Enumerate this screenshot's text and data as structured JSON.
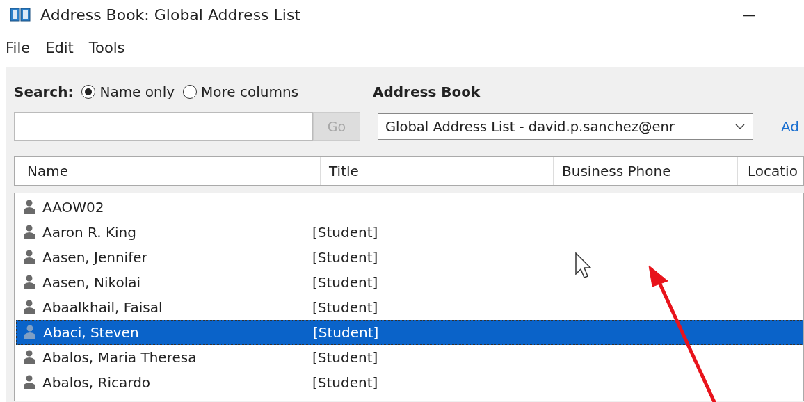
{
  "window": {
    "title": "Address Book: Global Address List",
    "minimize": "—"
  },
  "menu": [
    "File",
    "Edit",
    "Tools"
  ],
  "search": {
    "label": "Search:",
    "options": [
      {
        "label": "Name only",
        "selected": true
      },
      {
        "label": "More columns",
        "selected": false
      }
    ],
    "go": "Go",
    "go_disabled": true
  },
  "address_book": {
    "label": "Address Book",
    "value": "Global Address List - david.p.sanchez@enr",
    "link": "Ad"
  },
  "table": {
    "columns": [
      "Name",
      "Title",
      "Business Phone",
      "Locatio"
    ],
    "rows": [
      {
        "name": "AAOW02",
        "title": "",
        "selected": false
      },
      {
        "name": "Aaron R. King",
        "title": "[Student]",
        "selected": false
      },
      {
        "name": "Aasen, Jennifer",
        "title": "[Student]",
        "selected": false
      },
      {
        "name": "Aasen, Nikolai",
        "title": "[Student]",
        "selected": false
      },
      {
        "name": "Abaalkhail, Faisal",
        "title": "[Student]",
        "selected": false
      },
      {
        "name": "Abaci, Steven",
        "title": "[Student]",
        "selected": true
      },
      {
        "name": "Abalos, Maria Theresa",
        "title": "[Student]",
        "selected": false
      },
      {
        "name": "Abalos, Ricardo",
        "title": "[Student]",
        "selected": false
      }
    ]
  }
}
